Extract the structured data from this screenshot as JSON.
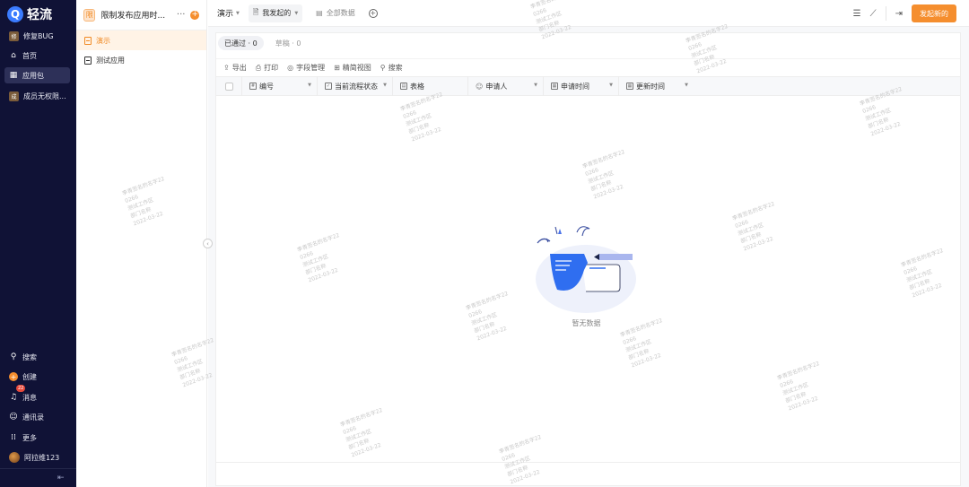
{
  "nav": {
    "brand": "轻流",
    "items": [
      {
        "label": "修复BUG",
        "tile": "修"
      },
      {
        "label": "首页"
      },
      {
        "label": "应用包"
      },
      {
        "label": "成员无权限...",
        "tile": "成"
      }
    ],
    "bottom_items": [
      {
        "label": "搜索"
      },
      {
        "label": "创建"
      },
      {
        "label": "消息",
        "badge": "22"
      },
      {
        "label": "通讯录"
      },
      {
        "label": "更多"
      },
      {
        "label": "阿拉维123"
      }
    ],
    "colors": {
      "bg": "#101236",
      "active": "#2d3058",
      "accent": "#f58e2e"
    }
  },
  "app": {
    "tile": "限",
    "name": "限制发布应用时...",
    "menu": [
      {
        "label": "演示",
        "active": true
      },
      {
        "label": "测试应用",
        "active": false
      }
    ]
  },
  "topbar": {
    "view": "演示",
    "tabs": [
      {
        "label": "我发起的",
        "active": true
      },
      {
        "label": "全部数据",
        "active": false
      }
    ],
    "new_button": "发起新的"
  },
  "subtabs": [
    {
      "label": "已通过 · 0",
      "active": true
    },
    {
      "label": "草稿 · 0",
      "active": false
    }
  ],
  "toolbar": [
    "导出",
    "打印",
    "字段管理",
    "精简视图",
    "搜索"
  ],
  "columns": [
    "编号",
    "当前流程状态",
    "表格",
    "申请人",
    "申请时间",
    "更新时间"
  ],
  "empty_text": "暂无数据",
  "watermark": [
    "李青签名的名字22",
    "0266",
    "测试工作区",
    "部门名称",
    "2022-03-22"
  ]
}
